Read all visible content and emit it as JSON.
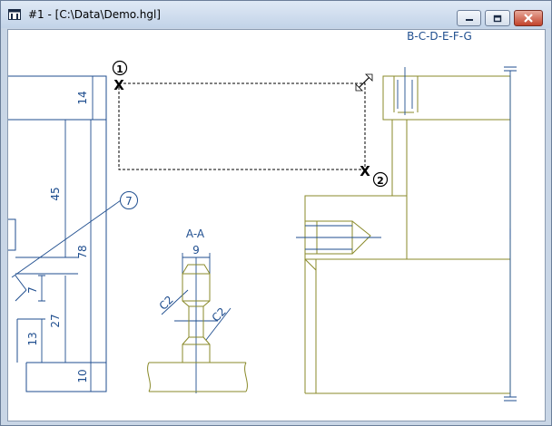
{
  "window": {
    "title": "#1 - [C:\\Data\\Demo.hgl]",
    "icons": [
      "app-window-icon",
      "minimize-icon",
      "restore-icon",
      "close-icon"
    ]
  },
  "drawing": {
    "header_text": "B-C-D-E-F-G",
    "section_label": "A-A",
    "dimensions": {
      "d14": "14",
      "d45": "45",
      "d78": "78",
      "d7": "7",
      "d27": "27",
      "d13": "13",
      "d10": "10",
      "d9": "9",
      "chamfer_left": "C2",
      "chamfer_right": "C2"
    },
    "balloon_number": "7",
    "selection": {
      "marker": "X",
      "point1_label": "1",
      "point2_label": "2"
    },
    "colors": {
      "dimension_blue": "#1f4e8f",
      "part_olive": "#8a8a2a",
      "selection_black": "#000000",
      "title_bg": "#c9d6e6"
    }
  }
}
